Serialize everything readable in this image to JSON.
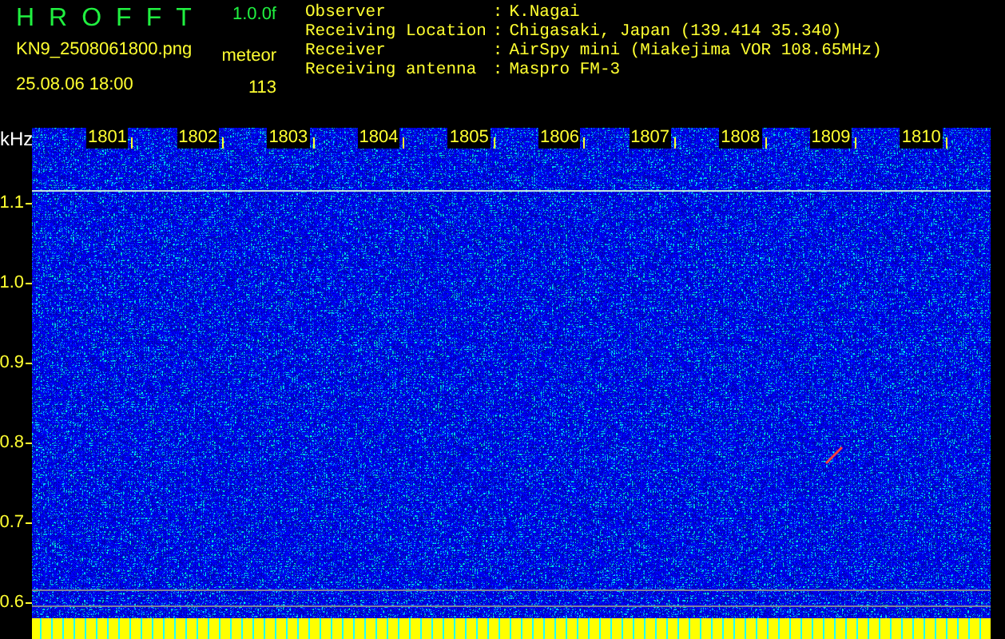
{
  "header": {
    "title": "HROFFT",
    "version": "1.0.0f",
    "filename": "KN9_2508061800.png",
    "datetime": "25.08.06 18:00",
    "count_label": "meteor",
    "count": "113"
  },
  "info": [
    {
      "label": "Observer",
      "separator": ":",
      "value": "K.Nagai"
    },
    {
      "label": "Receiving Location",
      "separator": ":",
      "value": "Chigasaki, Japan (139.414 35.340)"
    },
    {
      "label": "Receiver",
      "separator": ":",
      "value": "AirSpy mini (Miakejima VOR 108.65MHz)"
    },
    {
      "label": "Receiving antenna",
      "separator": ":",
      "value": "Maspro FM-3"
    }
  ],
  "spectrogram": {
    "y_unit": "kHz",
    "y_labels": [
      "1.1",
      "1.0",
      "0.9",
      "0.8",
      "0.7",
      "0.6"
    ],
    "time_labels": [
      "1801",
      "1802",
      "1803",
      "1804",
      "1805",
      "1806",
      "1807",
      "1808",
      "1809",
      "1810"
    ]
  }
}
